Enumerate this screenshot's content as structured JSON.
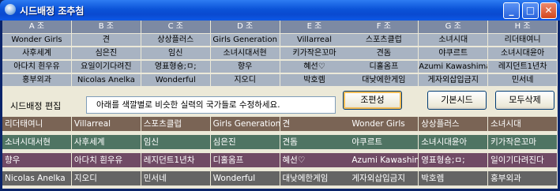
{
  "window": {
    "title": "시드배정 조추첨",
    "minimize_glyph": "_",
    "maximize_glyph": "□",
    "close_glyph": "✕"
  },
  "groups": {
    "headers": [
      "A 조",
      "B 조",
      "C 조",
      "D 조",
      "E 조",
      "F 조",
      "G 조",
      "H 조"
    ],
    "teams": [
      [
        "Wonder Girls",
        "사후세계",
        "아다치 흰우유",
        "홍부외과"
      ],
      [
        "견",
        "심은진",
        "요일이기다려진",
        "Nicolas Anelka"
      ],
      [
        "상상플러스",
        "임신",
        "영표형숑;ㅁ;",
        "Wonderful"
      ],
      [
        "Girls Generation",
        "소녀시대서현",
        "향우",
        "지오디"
      ],
      [
        "Villarreal",
        "키가작은꼬마",
        "혜선♡",
        "박호렘"
      ],
      [
        "스포츠클럽",
        "견돔",
        "디홀옴프",
        "대낮에한게임"
      ],
      [
        "소녀시대",
        "야쿠르트",
        "Azumi Kawashima",
        "게자외삽입금지"
      ],
      [
        "리더태여니",
        "소녀시대윤아",
        "레지던트1년차",
        "민서네"
      ]
    ]
  },
  "controls": {
    "status_label": "시드배정 편집",
    "hint": "아래를 색깔별로 비슷한 실력의 국가들로 수정하세요.",
    "regroup_button": "조편성",
    "default_seed_button": "기본시드",
    "delete_all_button": "모두삭제"
  },
  "seed_rows": [
    {
      "color": "#7a6455",
      "cells": [
        "리더태여니",
        "Villarreal",
        "스포츠클럽",
        "Girls Generation",
        "견",
        "Wonder Girls",
        "상상플러스",
        "소녀시대"
      ]
    },
    {
      "color": "#4f7463",
      "cells": [
        "소녀시대서현",
        "사후세계",
        "임신",
        "심은진",
        "견돔",
        "야쿠르트",
        "소녀시대윤아",
        "키가작은꼬마"
      ]
    },
    {
      "color": "#704a65",
      "cells": [
        "향우",
        "아다치 흰우유",
        "레지던트1년차",
        "디홀옴프",
        "혜선♡",
        "Azumi Kawashima",
        "영표형숑;ㅁ;",
        "일이기다려진다"
      ]
    },
    {
      "color": "#646464",
      "cells": [
        "Nicolas Anelka",
        "지오디",
        "민서네",
        "Wonderful",
        "대낮에한게임",
        "게자외삽입금지",
        "박호렘",
        "홍부외과"
      ]
    }
  ]
}
